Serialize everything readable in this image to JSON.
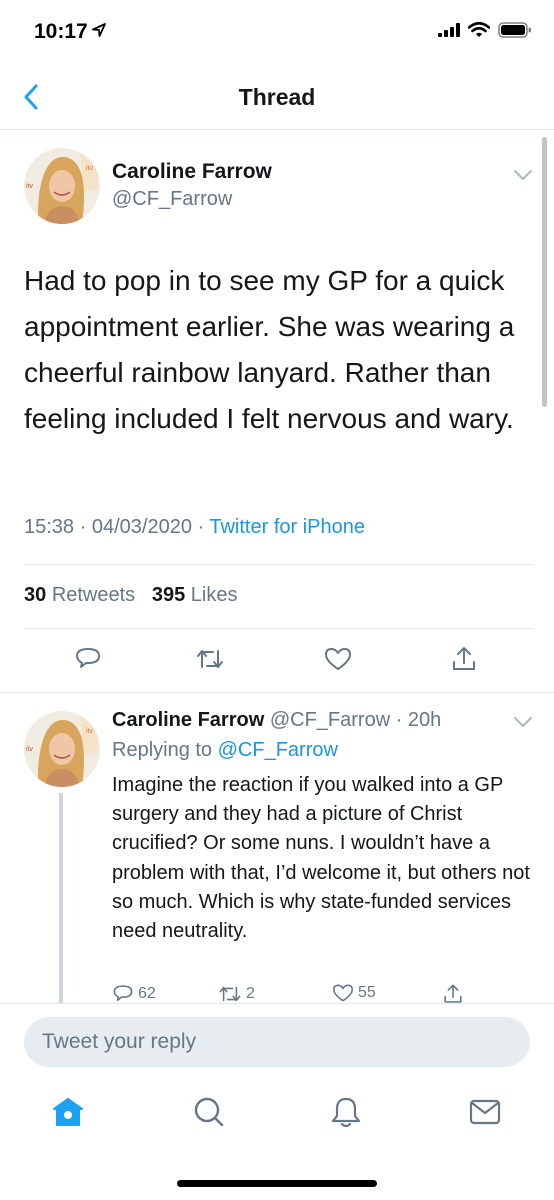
{
  "status_bar": {
    "time": "10:17"
  },
  "navbar": {
    "title": "Thread"
  },
  "main_tweet": {
    "author_name": "Caroline Farrow",
    "author_handle": "@CF_Farrow",
    "text": "Had to pop in to see my GP for a quick appointment earlier. She was wearing a cheerful rainbow lanyard. Rather than feeling included I felt nervous and wary.",
    "time": "15:38",
    "date": "04/03/2020",
    "source": "Twitter for iPhone",
    "retweets_count": "30",
    "retweets_label": "Retweets",
    "likes_count": "395",
    "likes_label": "Likes"
  },
  "reply_tweet": {
    "author_name": "Caroline Farrow",
    "author_handle": "@CF_Farrow",
    "age": "20h",
    "replying_label": "Replying to",
    "replying_to": "@CF_Farrow",
    "text": "Imagine the reaction if you walked into a GP surgery and they had a picture of Christ crucified? Or some nuns. I wouldn’t have a problem with that, I’d welcome it, but others not so much. Which is why state-funded services need neutrality.",
    "reply_count": "62",
    "retweet_count": "2",
    "like_count": "55"
  },
  "composer": {
    "placeholder": "Tweet your reply"
  },
  "tabbar": [
    "home-icon",
    "search-icon",
    "notifications-icon",
    "messages-icon"
  ],
  "colors": {
    "accent": "#1da1f2",
    "link": "#1b95e0",
    "muted": "#657786",
    "text": "#14171a"
  }
}
